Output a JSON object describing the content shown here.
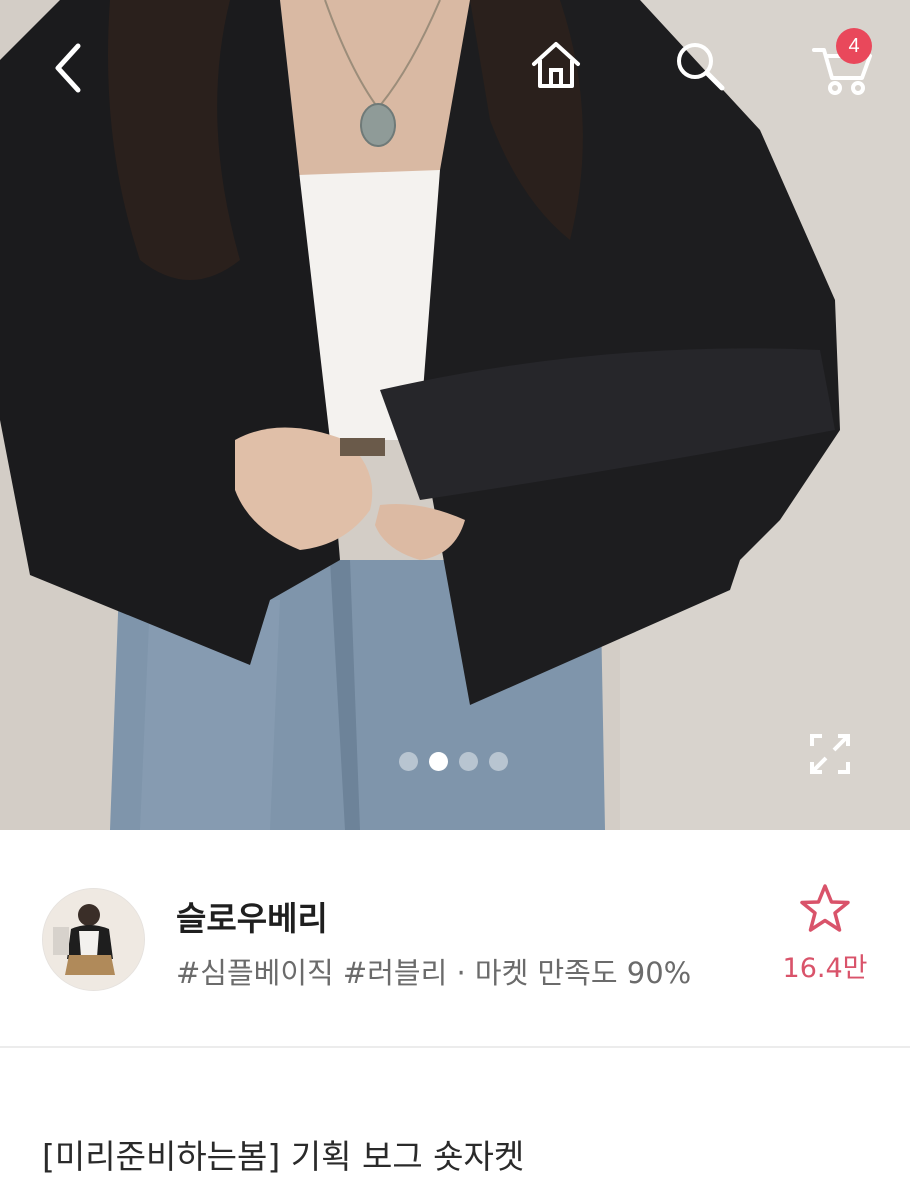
{
  "topbar": {
    "back_icon": "chevron-left-icon",
    "home_icon": "home-icon",
    "search_icon": "search-icon",
    "cart_icon": "cart-icon",
    "cart_count": "4"
  },
  "gallery": {
    "total_images": 4,
    "active_index": 1,
    "expand_icon": "expand-icon"
  },
  "seller": {
    "name": "슬로우베리",
    "tags": "#심플베이직 #러블리 · 마켓 만족도 90%",
    "favorite_icon": "star-outline-icon",
    "favorite_count": "16.4만",
    "accent_color": "#d9536a"
  },
  "product": {
    "title": "[미리준비하는봄] 기획 보그 숏자켓"
  },
  "colors": {
    "badge": "#e9485b",
    "divider": "#ececec"
  }
}
